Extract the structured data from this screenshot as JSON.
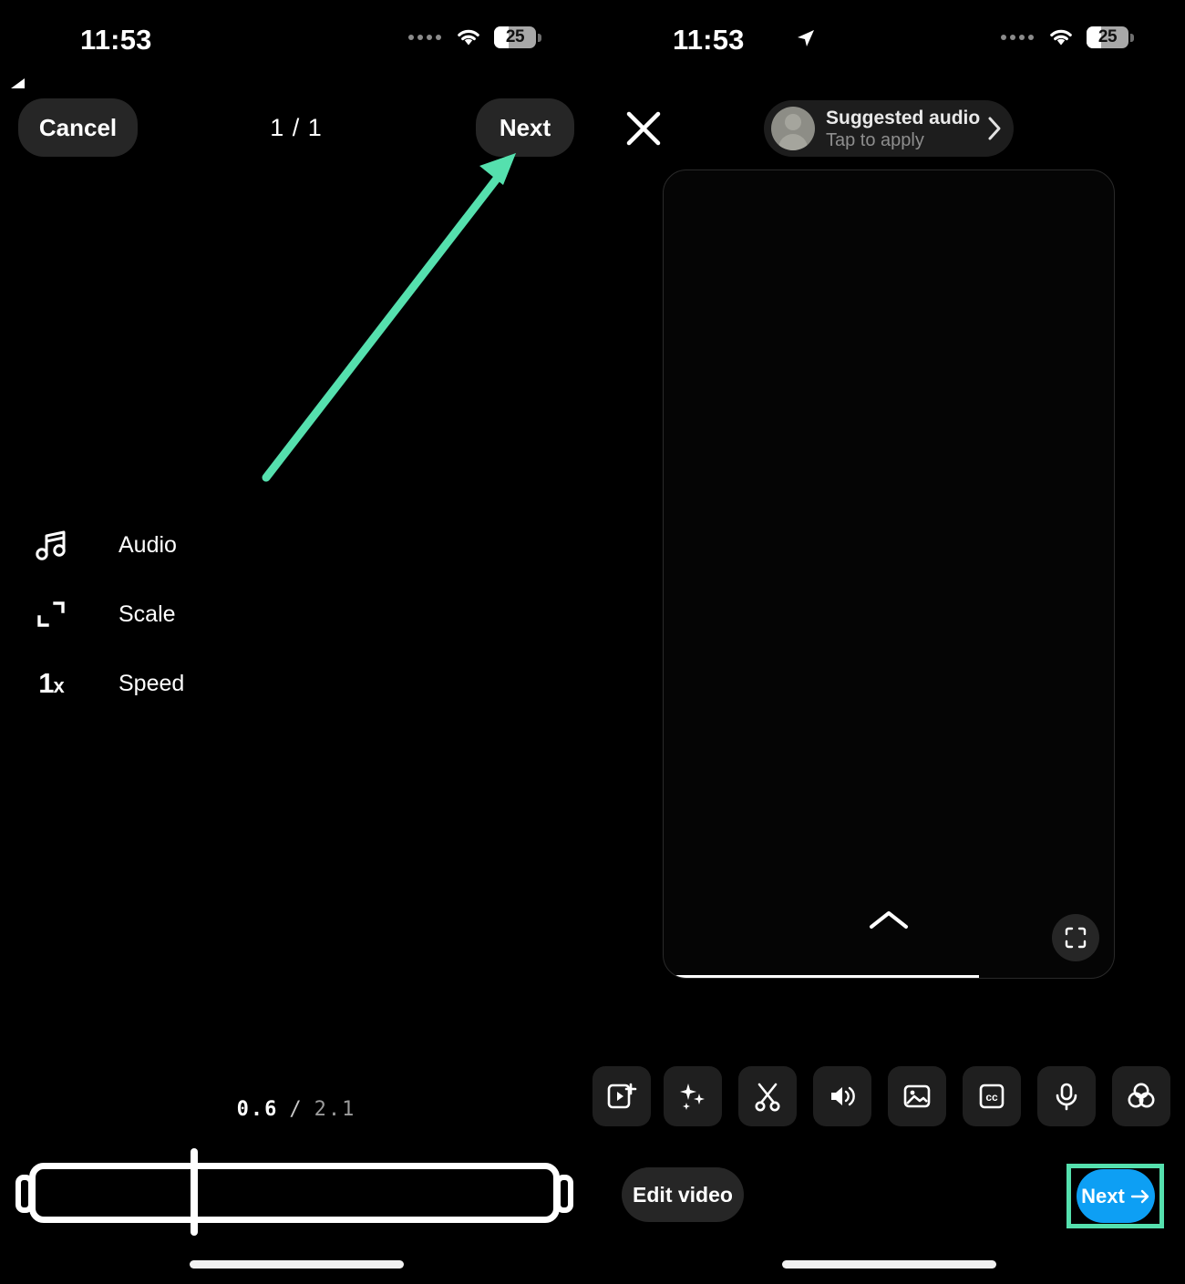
{
  "status_bar": {
    "time_left": "11:53",
    "time_right": "11:53",
    "battery_percent": "25",
    "wifi_icon": "wifi-icon",
    "location_icon": "location-arrow-icon",
    "signal_dots_icon": "signal-dots-icon"
  },
  "left_pane": {
    "cancel_label": "Cancel",
    "counter_label": "1 / 1",
    "next_label": "Next",
    "tools": [
      {
        "label": "Audio",
        "icon": "music-note-icon"
      },
      {
        "label": "Scale",
        "icon": "scale-crop-icon"
      },
      {
        "label": "Speed",
        "icon": "speed-1x-icon",
        "glyph": "1",
        "glyph_suffix": "x"
      }
    ],
    "timeline": {
      "current_time": "0.6",
      "separator": "/",
      "total_time": "2.1"
    }
  },
  "right_pane": {
    "close_icon": "close-x-icon",
    "audio_chip": {
      "title": "Suggested audio",
      "subtitle": "Tap to apply",
      "avatar_icon": "person-avatar-icon",
      "chevron_icon": "chevron-right-icon"
    },
    "preview": {
      "collapse_icon": "chevron-up-icon",
      "expand_icon": "expand-fullscreen-icon",
      "progress_percent": 70
    },
    "toolbar": [
      {
        "name": "add-clip-button",
        "icon": "add-video-clip-icon"
      },
      {
        "name": "effects-button",
        "icon": "sparkles-icon"
      },
      {
        "name": "trim-button",
        "icon": "scissors-icon"
      },
      {
        "name": "volume-button",
        "icon": "speaker-volume-icon"
      },
      {
        "name": "image-button",
        "icon": "photo-image-icon"
      },
      {
        "name": "captions-button",
        "icon": "closed-caption-cc-icon"
      },
      {
        "name": "voiceover-button",
        "icon": "microphone-icon"
      },
      {
        "name": "filters-button",
        "icon": "color-circles-icon"
      },
      {
        "name": "more-button",
        "icon": "color-circles-icon"
      }
    ],
    "edit_video_label": "Edit video",
    "next_label": "Next",
    "next_arrow_icon": "arrow-right-icon"
  },
  "annotation": {
    "arrow_color": "#55e0ae",
    "highlight_color": "#55e0ae",
    "target": "Next"
  },
  "colors": {
    "background": "#000000",
    "pill": "#262626",
    "chip": "#1d1d1d",
    "accent_blue": "#0d9ff4",
    "annotation_green": "#55e0ae"
  }
}
